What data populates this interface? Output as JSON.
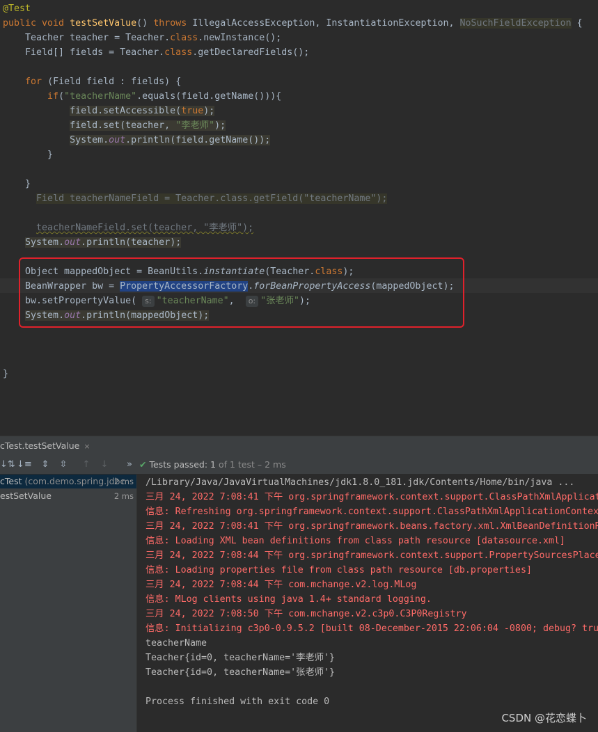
{
  "editor": {
    "lines": [
      {
        "segments": [
          {
            "t": "@Test",
            "c": "ann"
          }
        ]
      },
      {
        "segments": [
          {
            "t": "public void ",
            "c": "kw"
          },
          {
            "t": "testSetValue",
            "c": "fn"
          },
          {
            "t": "() ",
            "c": ""
          },
          {
            "t": "throws ",
            "c": "kw"
          },
          {
            "t": "IllegalAccessException, InstantiationException, ",
            "c": ""
          },
          {
            "t": "NoSuchFieldException",
            "c": "hl-warn ghost"
          },
          {
            "t": " {",
            "c": ""
          }
        ]
      },
      {
        "segments": [
          {
            "t": "    Teacher teacher = Teacher.",
            "c": ""
          },
          {
            "t": "class",
            "c": "kw"
          },
          {
            "t": ".newInstance();",
            "c": ""
          }
        ]
      },
      {
        "segments": [
          {
            "t": "    Field[] fields = Teacher.",
            "c": ""
          },
          {
            "t": "class",
            "c": "kw"
          },
          {
            "t": ".getDeclaredFields();",
            "c": ""
          }
        ]
      },
      {
        "segments": []
      },
      {
        "segments": [
          {
            "t": "    ",
            "c": ""
          },
          {
            "t": "for",
            "c": "kw"
          },
          {
            "t": " (Field field : fields) {",
            "c": ""
          }
        ]
      },
      {
        "segments": [
          {
            "t": "        ",
            "c": ""
          },
          {
            "t": "if",
            "c": "kw"
          },
          {
            "t": "(",
            "c": ""
          },
          {
            "t": "\"teacherName\"",
            "c": "str"
          },
          {
            "t": ".equals(field.getName())){",
            "c": ""
          }
        ]
      },
      {
        "segments": [
          {
            "t": "            ",
            "c": ""
          },
          {
            "t": "field.setAccessible(",
            "c": "hl-field"
          },
          {
            "t": "true",
            "c": "kw hl-field"
          },
          {
            "t": ");",
            "c": "hl-field"
          }
        ]
      },
      {
        "segments": [
          {
            "t": "            ",
            "c": ""
          },
          {
            "t": "field.set(teacher, ",
            "c": "hl-field"
          },
          {
            "t": "\"李老师\"",
            "c": "str hl-field"
          },
          {
            "t": ");",
            "c": "hl-field"
          }
        ]
      },
      {
        "segments": [
          {
            "t": "            ",
            "c": ""
          },
          {
            "t": "System.",
            "c": "hl-field"
          },
          {
            "t": "out",
            "c": "fld hl-field"
          },
          {
            "t": ".println(field.getName());",
            "c": "hl-field"
          }
        ]
      },
      {
        "segments": [
          {
            "t": "        }",
            "c": ""
          }
        ]
      },
      {
        "segments": []
      },
      {
        "segments": [
          {
            "t": "    }",
            "c": ""
          }
        ]
      },
      {
        "segments": [
          {
            "t": "      ",
            "c": ""
          },
          {
            "t": "Field teacherNameField = Teacher.class.getField(\"teacherName\");",
            "c": "hl-warn ghost"
          }
        ]
      },
      {
        "segments": []
      },
      {
        "segments": [
          {
            "t": "      ",
            "c": ""
          },
          {
            "t": "teacherNameField.set(teacher, \"李老师\");",
            "c": "ghost squig"
          }
        ]
      },
      {
        "segments": [
          {
            "t": "    ",
            "c": ""
          },
          {
            "t": "System.",
            "c": "hl-field"
          },
          {
            "t": "out",
            "c": "fld hl-field"
          },
          {
            "t": ".println(teacher);",
            "c": "hl-field"
          }
        ]
      },
      {
        "segments": []
      },
      {
        "segments": [
          {
            "t": "    Object mappedObject = BeanUtils.",
            "c": ""
          },
          {
            "t": "instantiate",
            "c": "it"
          },
          {
            "t": "(Teacher.",
            "c": ""
          },
          {
            "t": "class",
            "c": "kw"
          },
          {
            "t": ");",
            "c": ""
          }
        ]
      },
      {
        "segments": [
          {
            "t": "    BeanWrapper bw = ",
            "c": ""
          },
          {
            "t": "PropertyAccessorFactory",
            "c": "hl-sel"
          },
          {
            "t": ".",
            "c": ""
          },
          {
            "t": "forBeanPropertyAccess",
            "c": "it"
          },
          {
            "t": "(mappedObject);",
            "c": ""
          }
        ]
      },
      {
        "segments": [
          {
            "t": "    bw.setPropertyValue( ",
            "c": ""
          },
          {
            "hint": "s:"
          },
          {
            "t": "\"teacherName\"",
            "c": "str"
          },
          {
            "t": ",  ",
            "c": ""
          },
          {
            "hint": "o:"
          },
          {
            "t": "\"张老师\"",
            "c": "str"
          },
          {
            "t": ");",
            "c": ""
          }
        ]
      },
      {
        "segments": [
          {
            "t": "    ",
            "c": ""
          },
          {
            "t": "System.",
            "c": "hl-field"
          },
          {
            "t": "out",
            "c": "fld hl-field"
          },
          {
            "t": ".println(mappedObject);",
            "c": "hl-field"
          }
        ]
      },
      {
        "segments": []
      },
      {
        "segments": []
      },
      {
        "segments": []
      },
      {
        "segments": [
          {
            "t": "}",
            "c": ""
          }
        ]
      }
    ]
  },
  "run": {
    "tab_label": "cTest.testSetValue",
    "close_glyph": "×",
    "status_main": "Tests passed: 1",
    "status_sub": " of 1 test – 2 ms",
    "toolbar_icons": [
      "sort-alpha-icon",
      "sort-duration-icon",
      "expand-all-icon",
      "collapse-all-icon",
      "prev-failed-icon",
      "next-failed-icon",
      "more-icon"
    ]
  },
  "tree": {
    "items": [
      {
        "name": "cTest",
        "pkg": " (com.demo.spring.jdbc",
        "dur": "2 ms",
        "selected": true
      },
      {
        "name": "estSetValue",
        "pkg": "",
        "dur": "2 ms",
        "selected": false
      }
    ]
  },
  "console": {
    "lines": [
      {
        "t": "/Library/Java/JavaVirtualMachines/jdk1.8.0_181.jdk/Contents/Home/bin/java ...",
        "c": "c-norm"
      },
      {
        "t": "三月 24, 2022 7:08:41 下午 org.springframework.context.support.ClassPathXmlApplicat",
        "c": "c-err"
      },
      {
        "t": "信息: Refreshing org.springframework.context.support.ClassPathXmlApplicationContex",
        "c": "c-err"
      },
      {
        "t": "三月 24, 2022 7:08:41 下午 org.springframework.beans.factory.xml.XmlBeanDefinitionR",
        "c": "c-err"
      },
      {
        "t": "信息: Loading XML bean definitions from class path resource [datasource.xml]",
        "c": "c-err"
      },
      {
        "t": "三月 24, 2022 7:08:44 下午 org.springframework.context.support.PropertySourcesPlace",
        "c": "c-err"
      },
      {
        "t": "信息: Loading properties file from class path resource [db.properties]",
        "c": "c-err"
      },
      {
        "t": "三月 24, 2022 7:08:44 下午 com.mchange.v2.log.MLog",
        "c": "c-err"
      },
      {
        "t": "信息: MLog clients using java 1.4+ standard logging.",
        "c": "c-err"
      },
      {
        "t": "三月 24, 2022 7:08:50 下午 com.mchange.v2.c3p0.C3P0Registry",
        "c": "c-err"
      },
      {
        "t": "信息: Initializing c3p0-0.9.5.2 [built 08-December-2015 22:06:04 -0800; debug? tru",
        "c": "c-err"
      },
      {
        "t": "teacherName",
        "c": "c-norm"
      },
      {
        "t": "Teacher{id=0, teacherName='李老师'}",
        "c": "c-norm"
      },
      {
        "t": "Teacher{id=0, teacherName='张老师'}",
        "c": "c-norm"
      },
      {
        "t": "",
        "c": "c-norm"
      },
      {
        "t": "Process finished with exit code 0",
        "c": "c-norm"
      }
    ]
  },
  "watermark": "CSDN @花恋蝶卜"
}
